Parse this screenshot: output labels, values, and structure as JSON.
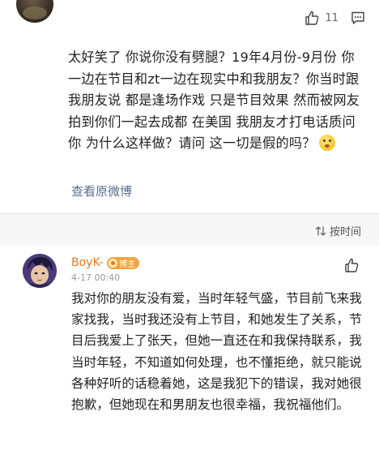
{
  "top_comment": {
    "like_count": "11",
    "text": "太好笑了 你说你没有劈腿？19年4月份-9月份 你一边在节目和zt一边在现实中和我朋友？你当时跟我朋友说 都是逢场作戏 只是节目效果 然而被网友拍到你们一起去成都 在美国 我朋友才打电话质问你 为什么这样做？请问 这一切是假的吗？",
    "emoji": "thinking-face-emoji",
    "view_original_label": "查看原微博"
  },
  "sort_bar": {
    "label": "按时间",
    "icon": "sort-arrows-icon"
  },
  "reply": {
    "username": "BoyK-",
    "badge_label": "博主",
    "timestamp": "4-17 00:40",
    "text": "我对你的朋友没有爱，当时年轻气盛，节目前飞来我家找我，当时我还没有上节目，和她发生了关系，节目后我爱上了张天，但她一直还在和我保持联系，我当时年轻，不知道如何处理，也不懂拒绝，就只能说各种好听的话稳着她，这是我犯下的错误，我对她很抱歉，但她现在和男朋友也很幸福，我祝福他们。"
  },
  "colors": {
    "username": "#e87722",
    "badge": "#f3a43b",
    "link": "#5b6d8c",
    "background": "#f2f2f2"
  }
}
